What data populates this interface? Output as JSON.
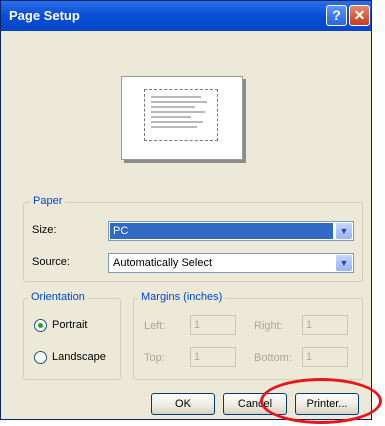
{
  "window": {
    "title": "Page Setup"
  },
  "title_buttons": {
    "help": "?",
    "close": "✕"
  },
  "paper": {
    "group_label": "Paper",
    "size_label": "Size:",
    "size_value": "PC",
    "source_label": "Source:",
    "source_value": "Automatically Select"
  },
  "orientation": {
    "group_label": "Orientation",
    "options": [
      {
        "label": "Portrait",
        "selected": true
      },
      {
        "label": "Landscape",
        "selected": false
      }
    ]
  },
  "margins": {
    "group_label": "Margins (inches)",
    "left_label": "Left:",
    "left_value": "1",
    "right_label": "Right:",
    "right_value": "1",
    "top_label": "Top:",
    "top_value": "1",
    "bottom_label": "Bottom:",
    "bottom_value": "1"
  },
  "buttons": {
    "ok": "OK",
    "cancel": "Cancel",
    "printer": "Printer..."
  },
  "annotation": {
    "color": "#e8151b",
    "shape": "ellipse around Printer button"
  },
  "colors": {
    "titlebar": "#0a4fd8",
    "selection": "#316ac5",
    "group_label": "#0046d5"
  }
}
